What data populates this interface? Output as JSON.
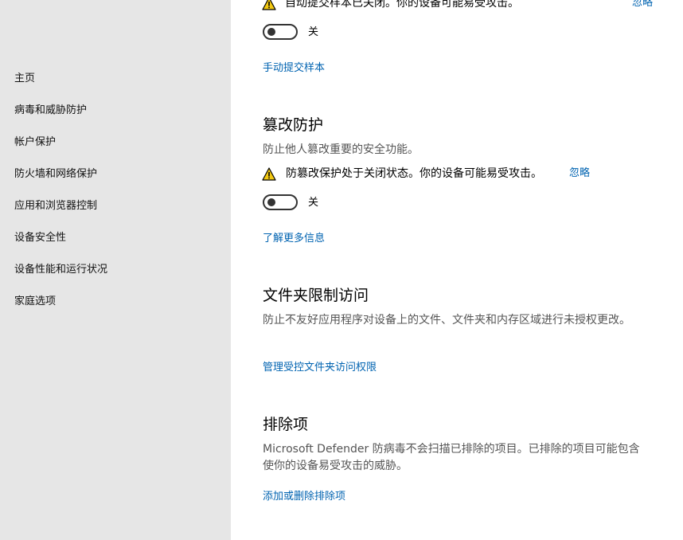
{
  "sidebar": {
    "items": [
      {
        "label": "主页"
      },
      {
        "label": "病毒和威胁防护"
      },
      {
        "label": "帐户保护"
      },
      {
        "label": "防火墙和网络保护"
      },
      {
        "label": "应用和浏览器控制"
      },
      {
        "label": "设备安全性"
      },
      {
        "label": "设备性能和运行状况"
      },
      {
        "label": "家庭选项"
      }
    ]
  },
  "sample_submission": {
    "warning_text": "自动提交样本已关闭。你的设备可能易受攻击。",
    "dismiss_label": "忽略",
    "toggle_state": "关",
    "link": "手动提交样本"
  },
  "tamper_protection": {
    "title": "篡改防护",
    "description": "防止他人篡改重要的安全功能。",
    "warning_text": "防篡改保护处于关闭状态。你的设备可能易受攻击。",
    "dismiss_label": "忽略",
    "toggle_state": "关",
    "link": "了解更多信息"
  },
  "controlled_folder_access": {
    "title": "文件夹限制访问",
    "description": "防止不友好应用程序对设备上的文件、文件夹和内存区域进行未授权更改。",
    "link": "管理受控文件夹访问权限"
  },
  "exclusions": {
    "title": "排除项",
    "description": "Microsoft Defender 防病毒不会扫描已排除的项目。已排除的项目可能包含使你的设备易受攻击的威胁。",
    "link": "添加或删除排除项"
  },
  "colors": {
    "sidebar_bg": "#e6e6e6",
    "link": "#0063b1",
    "warning": "#f2c811"
  },
  "icons": {
    "warning": "warning-triangle-icon"
  }
}
